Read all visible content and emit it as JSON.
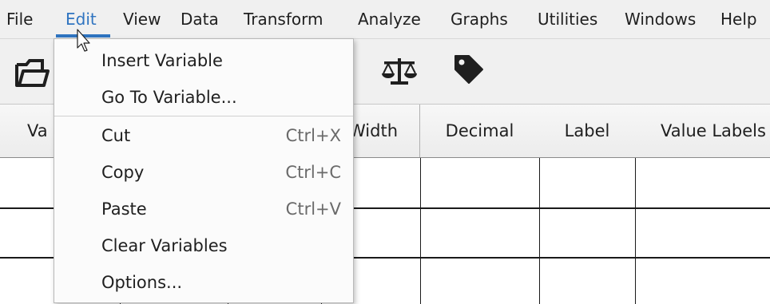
{
  "menubar": {
    "items": [
      "File",
      "Edit",
      "View",
      "Data",
      "Transform",
      "Analyze",
      "Graphs",
      "Utilities",
      "Windows",
      "Help"
    ],
    "active": "Edit"
  },
  "toolbar": {
    "icons": [
      "open-folder-icon",
      "scales-icon",
      "tag-icon"
    ]
  },
  "grid": {
    "headers": [
      "Va",
      "Width",
      "Decimal",
      "Label",
      "Value Labels"
    ]
  },
  "edit_menu": {
    "items": [
      {
        "label": "Insert Variable",
        "shortcut": ""
      },
      {
        "label": "Go To Variable...",
        "shortcut": ""
      },
      {
        "label": "Cut",
        "shortcut": "Ctrl+X"
      },
      {
        "label": "Copy",
        "shortcut": "Ctrl+C"
      },
      {
        "label": "Paste",
        "shortcut": "Ctrl+V"
      },
      {
        "label": "Clear Variables",
        "shortcut": ""
      },
      {
        "label": "Options...",
        "shortcut": ""
      }
    ]
  },
  "colors": {
    "accent": "#2f74c0",
    "menubar_bg": "#f0f0f0"
  }
}
